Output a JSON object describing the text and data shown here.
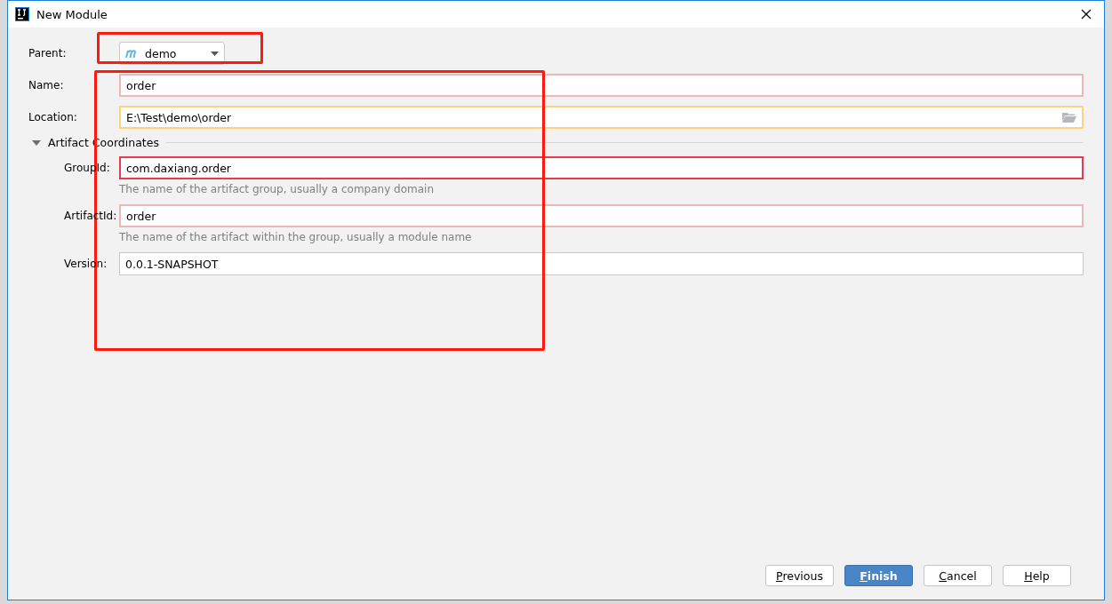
{
  "window": {
    "title": "New Module"
  },
  "parent": {
    "label": "Parent:",
    "value": "demo",
    "highlighted": true
  },
  "fields_highlighted": true,
  "fields": [
    {
      "label": "Name:",
      "value": "order",
      "invalid": true,
      "focused": false
    },
    {
      "label": "Location:",
      "value": "E:\\Test\\demo\\order",
      "invalid": false,
      "focused": true,
      "browse": true
    }
  ],
  "section": {
    "title": "Artifact Coordinates",
    "expanded": true,
    "fields": [
      {
        "label": "GroupId:",
        "value": "com.daxiang.order",
        "invalid": true,
        "focused": true,
        "hint": "The name of the artifact group, usually a company domain"
      },
      {
        "label": "ArtifactId:",
        "value": "order",
        "invalid": true,
        "focused": false,
        "hint": "The name of the artifact within the group, usually a module name"
      },
      {
        "label": "Version:",
        "value": "0.0.1-SNAPSHOT",
        "invalid": false,
        "focused": false
      }
    ]
  },
  "buttons": [
    {
      "label": "Previous",
      "primary": false
    },
    {
      "label": "Finish",
      "primary": true
    },
    {
      "label": "Cancel",
      "primary": false
    },
    {
      "label": "Help",
      "primary": false
    }
  ]
}
